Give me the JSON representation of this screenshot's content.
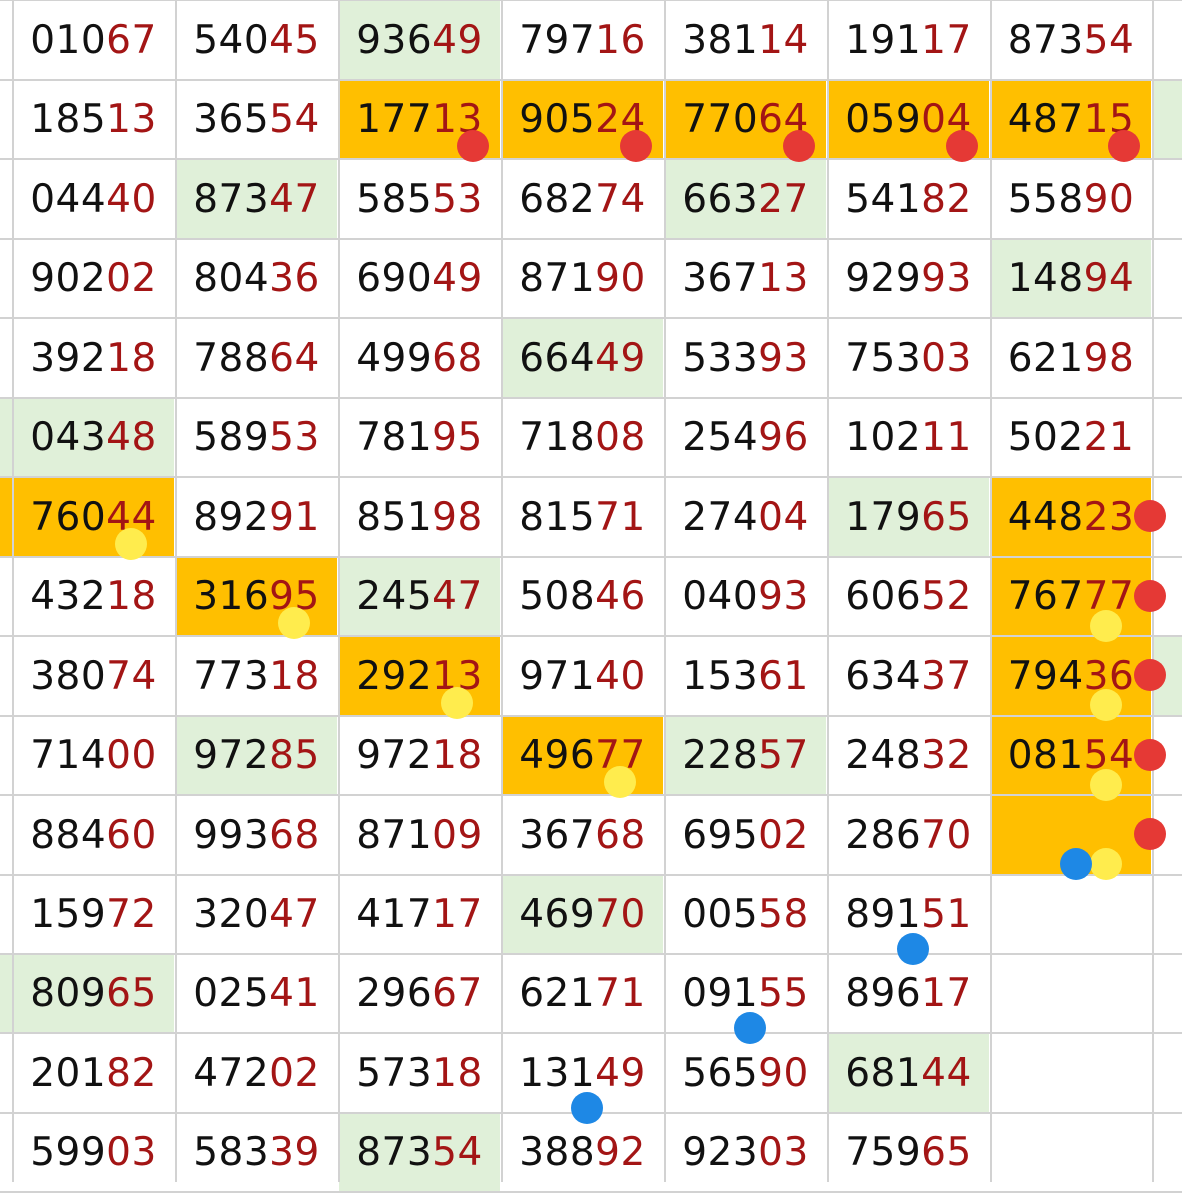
{
  "colors": {
    "highlight_orange": "#ffbf00",
    "highlight_green": "#e0f0d9",
    "prefix_text": "#111111",
    "suffix_text": "#a31515",
    "marker_red": "#e53935",
    "marker_yellow": "#ffec4d",
    "marker_blue": "#1e88e5",
    "grid_line": "#d2d2d2"
  },
  "columns": [
    [
      "01067",
      "18513",
      "04440",
      "90202",
      "39218",
      "04348",
      "76044",
      "43218",
      "38074",
      "71400",
      "88460",
      "15972",
      "80965",
      "20182",
      "59903"
    ],
    [
      "54045",
      "36554",
      "87347",
      "80436",
      "78864",
      "58953",
      "89291",
      "31695",
      "77318",
      "97285",
      "99368",
      "32047",
      "02541",
      "47202",
      "58339"
    ],
    [
      "93649",
      "17713",
      "58553",
      "69049",
      "49968",
      "78195",
      "85198",
      "24547",
      "29213",
      "97218",
      "87109",
      "41717",
      "29667",
      "57318",
      "87354"
    ],
    [
      "79716",
      "90524",
      "68274",
      "87190",
      "66449",
      "71808",
      "81571",
      "50846",
      "97140",
      "49677",
      "36768",
      "46970",
      "62171",
      "13149",
      "38892"
    ],
    [
      "38114",
      "77064",
      "66327",
      "36713",
      "53393",
      "25496",
      "27404",
      "04093",
      "15361",
      "22857",
      "69502",
      "00558",
      "09155",
      "56590",
      "92303"
    ],
    [
      "19117",
      "05904",
      "54182",
      "92993",
      "75303",
      "10211",
      "17965",
      "60652",
      "63437",
      "24832",
      "28670",
      "89151",
      "89617",
      "68144",
      "75965"
    ],
    [
      "87354",
      "48715",
      "55890",
      "14894",
      "62198",
      "50221",
      "44823",
      "76777",
      "79436",
      "08154",
      "",
      "",
      "",
      "",
      ""
    ]
  ],
  "highlights": {
    "orange": [
      [
        1,
        2
      ],
      [
        1,
        3
      ],
      [
        1,
        4
      ],
      [
        1,
        5
      ],
      [
        1,
        6
      ],
      [
        6,
        0
      ],
      [
        7,
        1
      ],
      [
        8,
        2
      ],
      [
        9,
        3
      ],
      [
        6,
        6
      ],
      [
        7,
        6
      ],
      [
        8,
        6
      ],
      [
        9,
        6
      ],
      [
        10,
        6
      ]
    ],
    "green": [
      [
        0,
        2
      ],
      [
        2,
        1
      ],
      [
        2,
        4
      ],
      [
        3,
        6
      ],
      [
        4,
        3
      ],
      [
        5,
        0
      ],
      [
        6,
        5
      ],
      [
        7,
        2
      ],
      [
        9,
        1
      ],
      [
        9,
        4
      ],
      [
        11,
        3
      ],
      [
        12,
        0
      ],
      [
        13,
        5
      ],
      [
        14,
        2
      ],
      [
        1,
        7
      ],
      [
        8,
        7
      ]
    ]
  },
  "markers": {
    "red": [
      [
        1,
        2
      ],
      [
        1,
        3
      ],
      [
        1,
        4
      ],
      [
        1,
        5
      ],
      [
        1,
        6
      ],
      [
        6,
        6
      ],
      [
        7,
        6
      ],
      [
        8,
        6
      ],
      [
        9,
        6
      ],
      [
        10,
        6
      ]
    ],
    "yellow": [
      [
        6,
        0
      ],
      [
        7,
        1
      ],
      [
        8,
        2
      ],
      [
        9,
        3
      ],
      [
        7,
        6
      ],
      [
        8,
        6
      ],
      [
        9,
        6
      ],
      [
        10,
        6
      ]
    ],
    "blue": [
      [
        10,
        6
      ],
      [
        11,
        5
      ],
      [
        12,
        4
      ],
      [
        13,
        3
      ]
    ]
  }
}
